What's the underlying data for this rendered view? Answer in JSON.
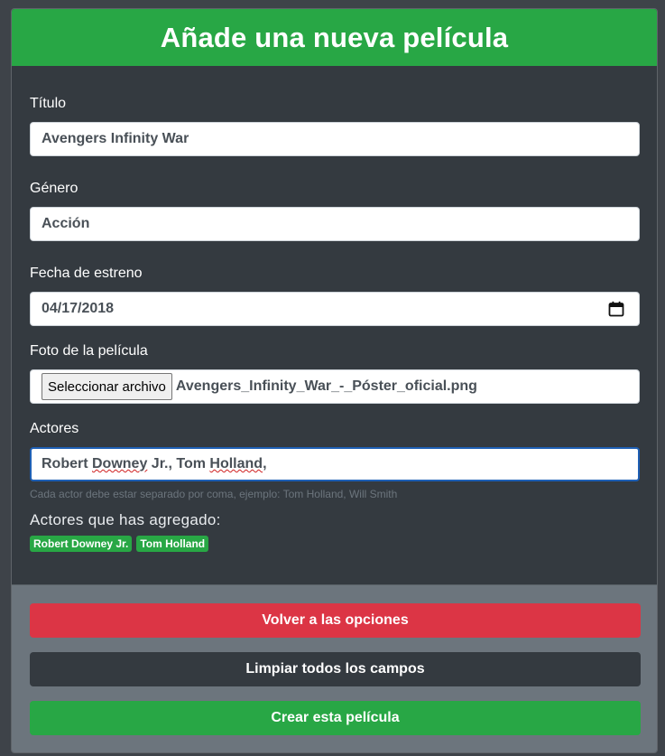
{
  "header": {
    "title": "Añade una nueva película"
  },
  "form": {
    "title": {
      "label": "Título",
      "value": "Avengers Infinity War"
    },
    "genre": {
      "label": "Género",
      "value": "Acción"
    },
    "release_date": {
      "label": "Fecha de estreno",
      "value": "04/17/2018",
      "icon": "calendar-icon"
    },
    "poster": {
      "label": "Foto de la película",
      "button_label": "Seleccionar archivo",
      "file_name": "Avengers_Infinity_War_-_Póster_oficial.png"
    },
    "actors": {
      "label": "Actores",
      "value_parts": [
        "Robert ",
        "Downey",
        " Jr., Tom ",
        "Holland",
        ","
      ],
      "help": "Cada actor debe estar separado por coma, ejemplo: Tom Holland, Will Smith",
      "added_title": "Actores que has agregado:",
      "added": [
        "Robert Downey Jr.",
        "Tom Holland"
      ]
    }
  },
  "footer": {
    "back_label": "Volver a las opciones",
    "clear_label": "Limpiar todos los campos",
    "create_label": "Crear esta película"
  },
  "colors": {
    "success": "#28a745",
    "danger": "#dc3545",
    "dark": "#343a40",
    "secondary": "#6c757d"
  }
}
